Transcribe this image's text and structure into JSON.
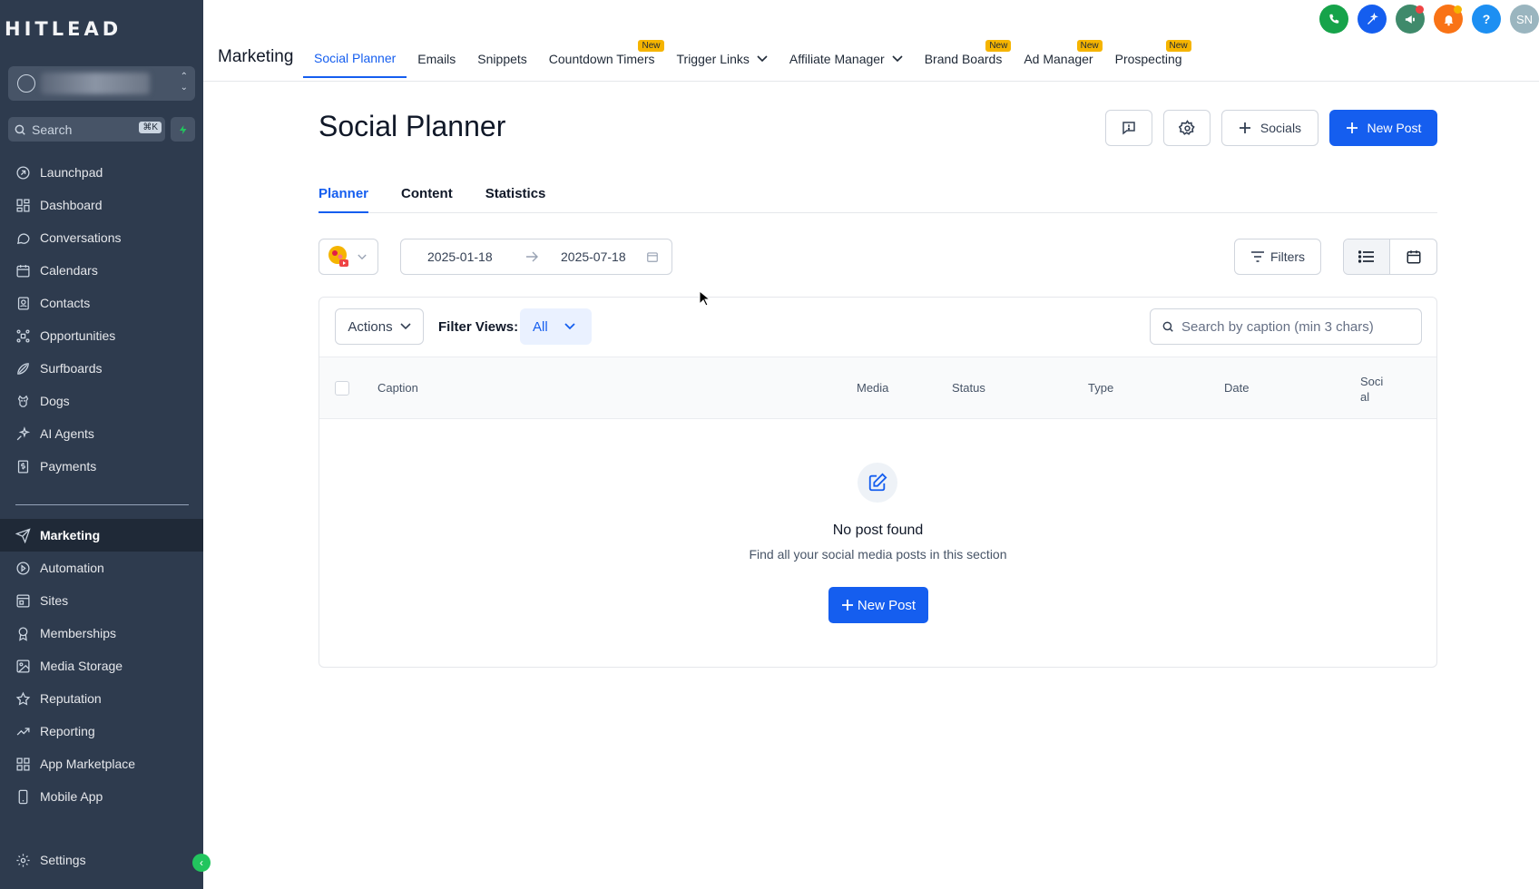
{
  "sidebar": {
    "logo": "HITLEAD",
    "search": {
      "label": "Search",
      "shortcut": "⌘K"
    },
    "items": [
      {
        "label": "Launchpad",
        "icon": "rocket-icon"
      },
      {
        "label": "Dashboard",
        "icon": "grid-icon"
      },
      {
        "label": "Conversations",
        "icon": "chat-icon"
      },
      {
        "label": "Calendars",
        "icon": "calendar-icon"
      },
      {
        "label": "Contacts",
        "icon": "contact-icon"
      },
      {
        "label": "Opportunities",
        "icon": "pipeline-icon"
      },
      {
        "label": "Surfboards",
        "icon": "surfboard-icon"
      },
      {
        "label": "Dogs",
        "icon": "dog-icon"
      },
      {
        "label": "AI Agents",
        "icon": "sparkle-icon"
      },
      {
        "label": "Payments",
        "icon": "receipt-icon"
      }
    ],
    "items2": [
      {
        "label": "Marketing",
        "icon": "send-icon",
        "active": true
      },
      {
        "label": "Automation",
        "icon": "automation-icon"
      },
      {
        "label": "Sites",
        "icon": "sites-icon"
      },
      {
        "label": "Memberships",
        "icon": "award-icon"
      },
      {
        "label": "Media Storage",
        "icon": "image-icon"
      },
      {
        "label": "Reputation",
        "icon": "star-icon"
      },
      {
        "label": "Reporting",
        "icon": "trend-icon"
      },
      {
        "label": "App Marketplace",
        "icon": "apps-icon"
      },
      {
        "label": "Mobile App",
        "icon": "phone-icon"
      }
    ],
    "settings": "Settings"
  },
  "header": {
    "section": "Marketing",
    "tabs": [
      {
        "label": "Social Planner",
        "active": true
      },
      {
        "label": "Emails"
      },
      {
        "label": "Snippets"
      },
      {
        "label": "Countdown Timers",
        "badge": "New"
      },
      {
        "label": "Trigger Links",
        "dropdown": true
      },
      {
        "label": "Affiliate Manager",
        "dropdown": true
      },
      {
        "label": "Brand Boards",
        "badge": "New"
      },
      {
        "label": "Ad Manager",
        "badge": "New"
      },
      {
        "label": "Prospecting",
        "badge": "New"
      }
    ],
    "avatar_initials": "SN",
    "help": "?"
  },
  "page": {
    "title": "Social Planner",
    "buttons": {
      "socials": "Socials",
      "new_post": "New Post"
    },
    "subtabs": [
      "Planner",
      "Content",
      "Statistics"
    ],
    "date_from": "2025-01-18",
    "date_to": "2025-07-18",
    "filters": "Filters"
  },
  "table": {
    "actions": "Actions",
    "filter_views_label": "Filter Views:",
    "filter_views_value": "All",
    "search_placeholder": "Search by caption (min 3 chars)",
    "columns": {
      "caption": "Caption",
      "media": "Media",
      "status": "Status",
      "type": "Type",
      "date": "Date",
      "social": "Social"
    },
    "empty_title": "No post found",
    "empty_subtitle": "Find all your social media posts in this section",
    "empty_button": "New Post"
  },
  "colors": {
    "sidebar": "#2e3b4e",
    "primary": "#155eef",
    "badge": "#f5b400"
  }
}
